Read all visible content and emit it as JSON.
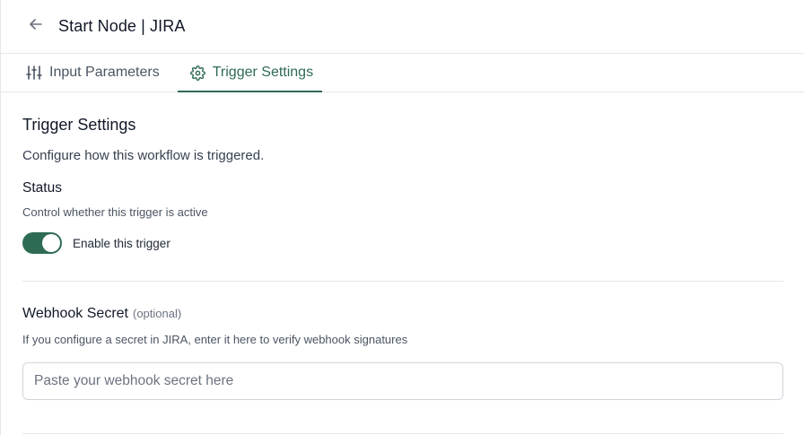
{
  "header": {
    "title": "Start Node | JIRA",
    "back_icon": "arrow-left-icon"
  },
  "tabs": [
    {
      "label": "Input Parameters",
      "icon": "sliders-icon",
      "active": false
    },
    {
      "label": "Trigger Settings",
      "icon": "gear-icon",
      "active": true
    }
  ],
  "trigger": {
    "title": "Trigger Settings",
    "description": "Configure how this workflow is triggered."
  },
  "status": {
    "label": "Status",
    "description": "Control whether this trigger is active",
    "toggle_label": "Enable this trigger",
    "enabled": true
  },
  "webhook": {
    "label": "Webhook Secret",
    "optional": "(optional)",
    "description": "If you configure a secret in JIRA, enter it here to verify webhook signatures",
    "placeholder": "Paste your webhook secret here",
    "value": ""
  },
  "colors": {
    "accent": "#2e6b53",
    "border": "#e5e7eb",
    "text": "#111827",
    "muted": "#4b5563"
  }
}
